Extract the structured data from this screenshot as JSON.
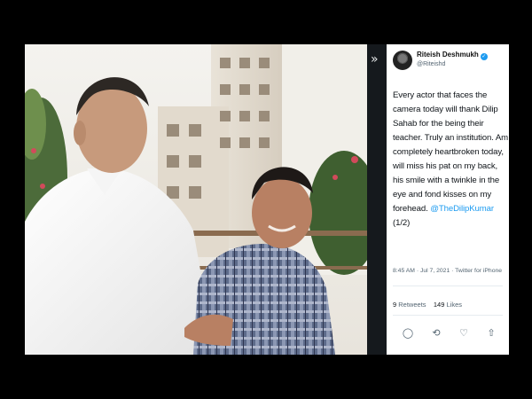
{
  "tweet": {
    "author_name": "Riteish Deshmukh",
    "verified_mark": "✓",
    "handle": "@Riteishd",
    "text_main": "Every actor that faces the camera today will thank Dilip Sahab for the being their teacher. Truly an institution. Am completely heartbroken today, will miss his pat on my back, his smile with a twinkle in the eye and fond kisses on my forehead.",
    "mention": "@TheDilipKumar",
    "text_suffix": "(1/2)",
    "meta": "8:45 AM · Jul 7, 2021 · Twitter for iPhone",
    "retweets_count": "9",
    "retweets_label": "Retweets",
    "likes_count": "149",
    "likes_label": "Likes"
  },
  "icons": {
    "collapse": "chevron-right-icon",
    "reply": "reply-icon",
    "retweet": "retweet-icon",
    "like": "heart-icon",
    "share": "share-icon"
  },
  "colors": {
    "accent": "#1d9bf0",
    "background": "#000000",
    "panel": "#ffffff",
    "muted_text": "#536471"
  }
}
